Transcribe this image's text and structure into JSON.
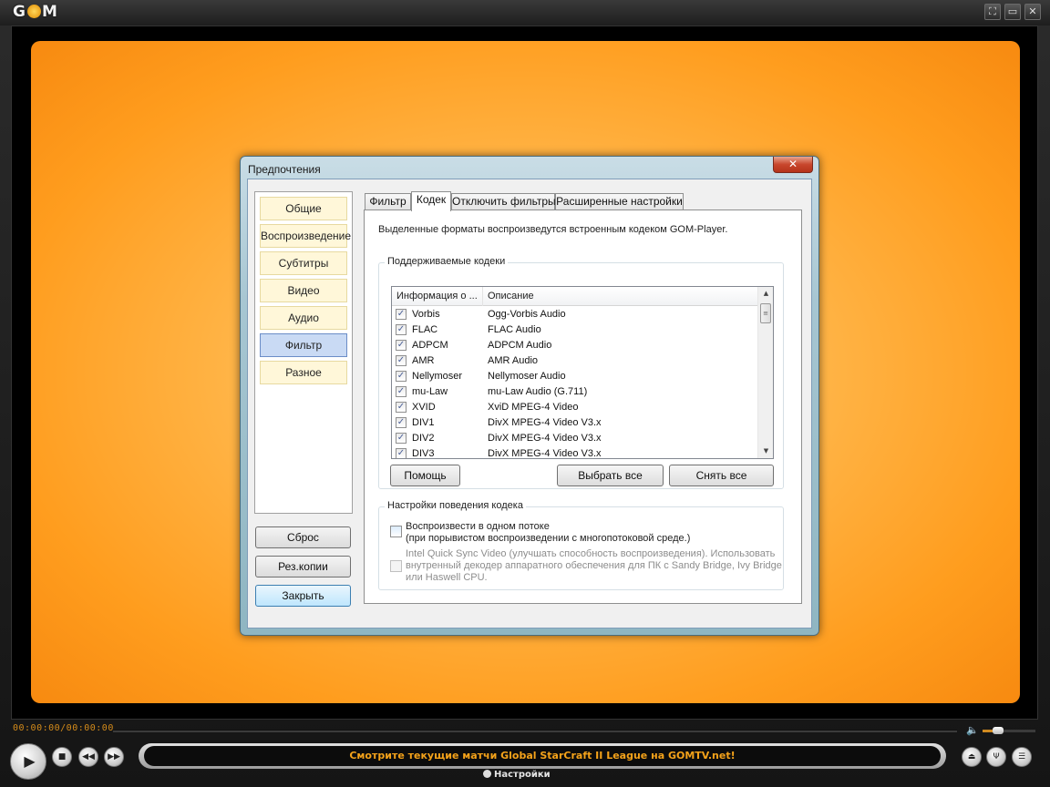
{
  "app": {
    "logo_text": "GOM",
    "window_buttons": [
      "⛶",
      "▭",
      "✕"
    ]
  },
  "playback": {
    "time_display": "00:00:00/00:00:00",
    "volume_level": 0.3
  },
  "controls": {
    "ticker_text": "Смотрите текущие матчи Global StarCraft II League на GOMTV.net!",
    "settings_label": "Настройки"
  },
  "dialog": {
    "title": "Предпочтения",
    "close_glyph": "✕",
    "categories": [
      {
        "label": "Общие",
        "active": false
      },
      {
        "label": "Воспроизведение",
        "active": false
      },
      {
        "label": "Субтитры",
        "active": false
      },
      {
        "label": "Видео",
        "active": false
      },
      {
        "label": "Аудио",
        "active": false
      },
      {
        "label": "Фильтр",
        "active": true
      },
      {
        "label": "Разное",
        "active": false
      }
    ],
    "side_buttons": {
      "reset": "Сброс",
      "backup": "Рез.копии",
      "close": "Закрыть"
    },
    "tabs": [
      {
        "label": "Фильтр",
        "active": false
      },
      {
        "label": "Кодек",
        "active": true
      },
      {
        "label": "Отключить фильтры",
        "active": false
      },
      {
        "label": "Расширенные настройки",
        "active": false
      }
    ],
    "codec_page": {
      "description": "Выделенные форматы воспроизведутся встроенным кодеком GOM-Player.",
      "supported_group": "Поддерживаемые кодеки",
      "columns": [
        "Информация о ...",
        "Описание"
      ],
      "codecs": [
        {
          "name": "Vorbis",
          "desc": "Ogg-Vorbis Audio",
          "checked": true
        },
        {
          "name": "FLAC",
          "desc": "FLAC Audio",
          "checked": true
        },
        {
          "name": "ADPCM",
          "desc": "ADPCM Audio",
          "checked": true
        },
        {
          "name": "AMR",
          "desc": "AMR Audio",
          "checked": true
        },
        {
          "name": "Nellymoser",
          "desc": "Nellymoser Audio",
          "checked": true
        },
        {
          "name": "mu-Law",
          "desc": "mu-Law Audio (G.711)",
          "checked": true
        },
        {
          "name": "XVID",
          "desc": "XviD MPEG-4 Video",
          "checked": true
        },
        {
          "name": "DIV1",
          "desc": "DivX MPEG-4 Video V3.x",
          "checked": true
        },
        {
          "name": "DIV2",
          "desc": "DivX MPEG-4 Video V3.x",
          "checked": true
        },
        {
          "name": "DIV3",
          "desc": "DivX MPEG-4 Video V3.x",
          "checked": true
        }
      ],
      "buttons": {
        "help": "Помощь",
        "select_all": "Выбрать все",
        "deselect_all": "Снять все"
      },
      "behavior_group": "Настройки поведения кодека",
      "option_single_thread_line1": "Воспроизвести в одном потоке",
      "option_single_thread_line2": "(при порывистом воспроизведении с многопотоковой среде.)",
      "option_quicksync_line1": "Intel Quick Sync Video (улучшать способность воспроизведения). Использовать",
      "option_quicksync_line2": "внутренный декодер аппаратного обеспечения для ПК с Sandy Bridge, Ivy Bridge",
      "option_quicksync_line3": "или Haswell CPU."
    }
  }
}
